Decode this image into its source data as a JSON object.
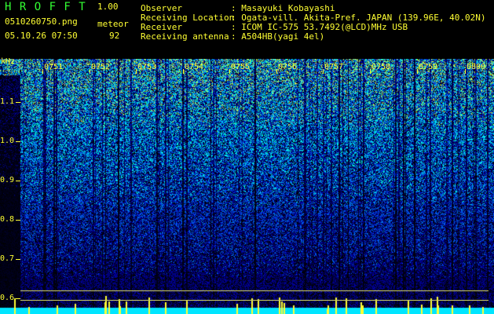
{
  "app": {
    "title": "H R O F F T",
    "version": "1.00",
    "filename": "0510260750.png",
    "mode": "meteor",
    "datetime": "05.10.26 07:50",
    "count": "92"
  },
  "info": [
    {
      "label": "Observer",
      "value": ": Masayuki Kobayashi"
    },
    {
      "label": "Receiving Location",
      "value": ": Ogata-vill. Akita-Pref. JAPAN (139.96E, 40.02N)"
    },
    {
      "label": "Receiver",
      "value": ": ICOM IC-575 53.7492(@LCD)MHz USB"
    },
    {
      "label": "Receiving antenna",
      "value": ": A504HB(yagi 4el)"
    }
  ],
  "spectrogram": {
    "unit": "kHz",
    "freq_labels": [
      "1.1",
      "1.0",
      "0.9",
      "0.8",
      "0.7",
      "0.6"
    ],
    "time_labels": [
      "0751",
      "0752",
      "0753",
      "0754",
      "0755",
      "0756",
      "0757",
      "0758",
      "0759",
      "0800"
    ]
  },
  "colors": {
    "title": "#33ff33",
    "axis": "#ffff33",
    "text": "#ffffff",
    "baseline": "#00e5ff"
  }
}
